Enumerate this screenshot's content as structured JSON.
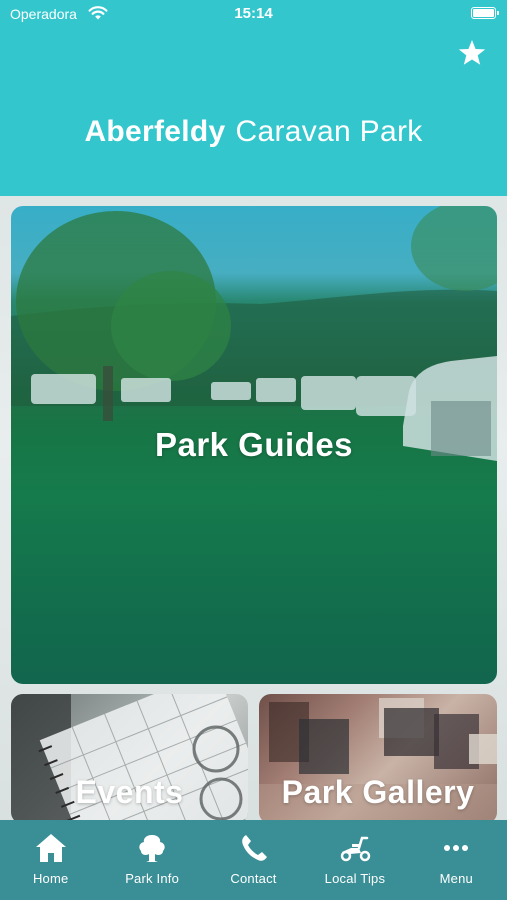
{
  "status_bar": {
    "carrier": "Operadora",
    "time": "15:14"
  },
  "header": {
    "title_bold": "Aberfeldy",
    "title_light": "Caravan Park"
  },
  "tiles": {
    "main": {
      "label": "Park Guides"
    },
    "events": {
      "label": "Events"
    },
    "gallery": {
      "label": "Park Gallery"
    }
  },
  "tabbar": {
    "items": [
      {
        "label": "Home",
        "icon": "home-icon"
      },
      {
        "label": "Park Info",
        "icon": "tree-icon"
      },
      {
        "label": "Contact",
        "icon": "phone-icon"
      },
      {
        "label": "Local Tips",
        "icon": "scooter-icon"
      },
      {
        "label": "Menu",
        "icon": "more-icon"
      }
    ]
  },
  "colors": {
    "header": "#33c7cd",
    "tabbar": "#3a8f96",
    "text": "#ffffff"
  }
}
